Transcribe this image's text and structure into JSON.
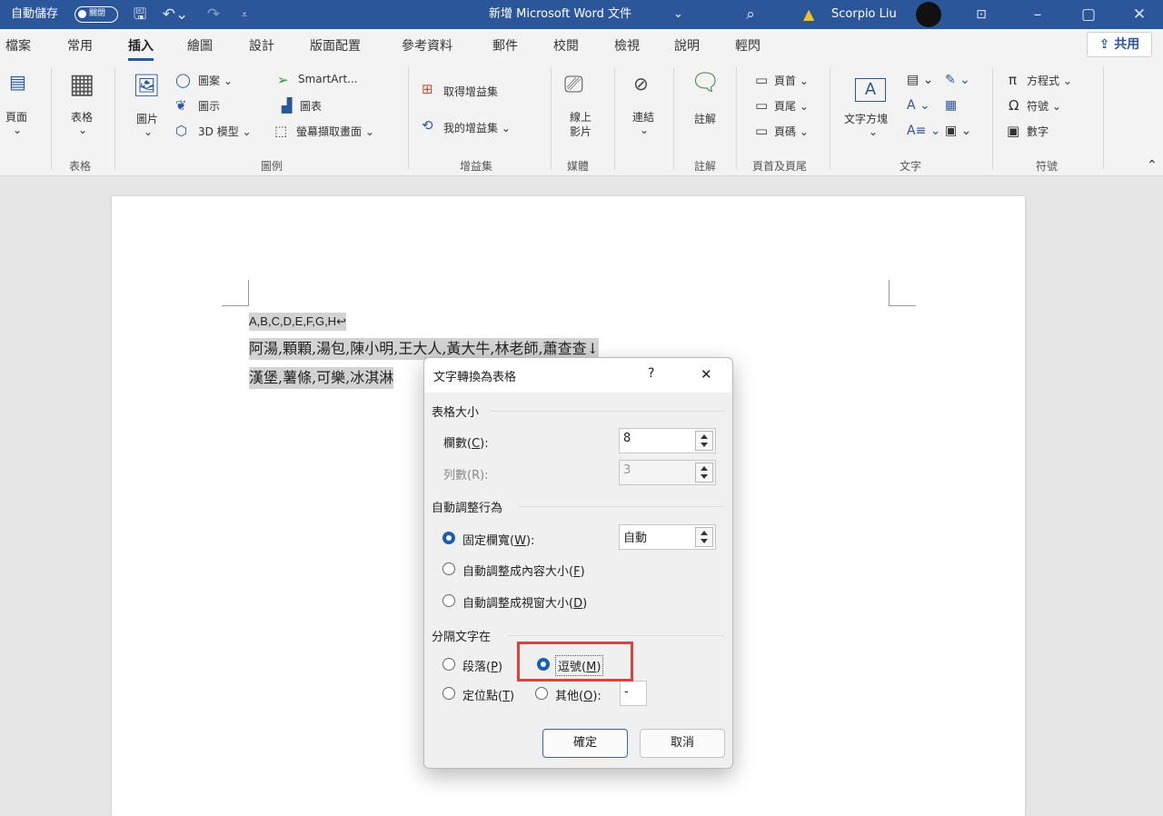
{
  "titlebar": {
    "autosave_label": "自動儲存",
    "autosave_state": "關閉",
    "doc_title": "新增 Microsoft Word 文件",
    "user_name": "Scorpio Liu"
  },
  "tabs": [
    "檔案",
    "常用",
    "插入",
    "繪圖",
    "設計",
    "版面配置",
    "參考資料",
    "郵件",
    "校閱",
    "檢視",
    "說明",
    "輕閃"
  ],
  "active_tab": "插入",
  "share_label": "共用",
  "ribbon": {
    "page": "頁面",
    "table": "表格",
    "picture": "圖片",
    "shapes": "圖案",
    "icons": "圖示",
    "models_3d": "3D 模型",
    "smartart": "SmartArt...",
    "chart": "圖表",
    "screenshot": "螢幕擷取畫面",
    "get_addins": "取得增益集",
    "my_addins": "我的增益集",
    "online_video_1": "線上",
    "online_video_2": "影片",
    "link": "連結",
    "comment": "註解",
    "header": "頁首",
    "footer": "頁尾",
    "page_number": "頁碼",
    "text_box": "文字方塊",
    "equation": "方程式",
    "symbol": "符號",
    "number": "數字",
    "groups": {
      "table": "表格",
      "illustrations": "圖例",
      "addins": "增益集",
      "media": "媒體",
      "comments": "註解",
      "header_footer": "頁首及頁尾",
      "text": "文字",
      "symbols": "符號"
    }
  },
  "document": {
    "line1": "A,B,C,D,E,F,G,H↩",
    "line2": "阿湯,顆顆,湯包,陳小明,王大人,黃大牛,林老師,蕭查查↓",
    "line3": "漢堡,薯條,可樂,冰淇淋"
  },
  "dialog": {
    "title": "文字轉換為表格",
    "help": "?",
    "close": "✕",
    "section_size": "表格大小",
    "cols_label": "欄數",
    "cols_key": "C",
    "cols_value": "8",
    "rows_label": "列數(R):",
    "rows_value": "3",
    "section_autofit": "自動調整行為",
    "fixed_label": "固定欄寬",
    "fixed_key": "W",
    "fixed_value": "自動",
    "autofit_content_label": "自動調整成內容大小",
    "autofit_content_key": "F",
    "autofit_window_label": "自動調整成視窗大小",
    "autofit_window_key": "D",
    "section_separator": "分隔文字在",
    "paragraph_label": "段落",
    "paragraph_key": "P",
    "comma_label": "逗號",
    "comma_key": "M",
    "tab_label": "定位點",
    "tab_key": "T",
    "other_label": "其他",
    "other_key": "O",
    "other_value": "-",
    "ok": "確定",
    "cancel": "取消"
  },
  "colors": {
    "accent": "#2b579a",
    "highlight": "#e04040",
    "radio_selected": "#1a5fb4"
  }
}
